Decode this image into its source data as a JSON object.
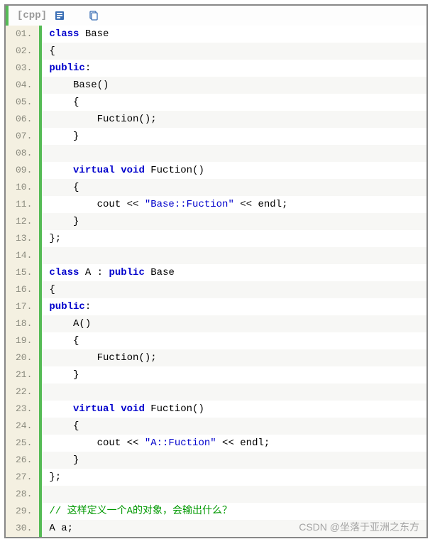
{
  "header": {
    "lang": "[cpp]"
  },
  "icons": {
    "view_plain": "view-plain-icon",
    "copy": "copy-icon"
  },
  "gutter_format": "00.",
  "lines": [
    [
      [
        "kw",
        "class"
      ],
      [
        "plain",
        " Base"
      ]
    ],
    [
      [
        "plain",
        "{"
      ]
    ],
    [
      [
        "kw",
        "public"
      ],
      [
        "plain",
        ":"
      ]
    ],
    [
      [
        "plain",
        "    Base()"
      ]
    ],
    [
      [
        "plain",
        "    {"
      ]
    ],
    [
      [
        "plain",
        "        Fuction();"
      ]
    ],
    [
      [
        "plain",
        "    }"
      ]
    ],
    [],
    [
      [
        "plain",
        "    "
      ],
      [
        "kw",
        "virtual"
      ],
      [
        "plain",
        " "
      ],
      [
        "kw",
        "void"
      ],
      [
        "plain",
        " Fuction()"
      ]
    ],
    [
      [
        "plain",
        "    {"
      ]
    ],
    [
      [
        "plain",
        "        cout << "
      ],
      [
        "str",
        "\"Base::Fuction\""
      ],
      [
        "plain",
        " << endl;"
      ]
    ],
    [
      [
        "plain",
        "    }"
      ]
    ],
    [
      [
        "plain",
        "};"
      ]
    ],
    [],
    [
      [
        "kw",
        "class"
      ],
      [
        "plain",
        " A : "
      ],
      [
        "kw",
        "public"
      ],
      [
        "plain",
        " Base"
      ]
    ],
    [
      [
        "plain",
        "{"
      ]
    ],
    [
      [
        "kw",
        "public"
      ],
      [
        "plain",
        ":"
      ]
    ],
    [
      [
        "plain",
        "    A()"
      ]
    ],
    [
      [
        "plain",
        "    {"
      ]
    ],
    [
      [
        "plain",
        "        Fuction();"
      ]
    ],
    [
      [
        "plain",
        "    }"
      ]
    ],
    [],
    [
      [
        "plain",
        "    "
      ],
      [
        "kw",
        "virtual"
      ],
      [
        "plain",
        " "
      ],
      [
        "kw",
        "void"
      ],
      [
        "plain",
        " Fuction()"
      ]
    ],
    [
      [
        "plain",
        "    {"
      ]
    ],
    [
      [
        "plain",
        "        cout << "
      ],
      [
        "str",
        "\"A::Fuction\""
      ],
      [
        "plain",
        " << endl;"
      ]
    ],
    [
      [
        "plain",
        "    }"
      ]
    ],
    [
      [
        "plain",
        "};"
      ]
    ],
    [],
    [
      [
        "comment",
        "// 这样定义一个A的对象，会输出什么？"
      ]
    ],
    [
      [
        "plain",
        "A a;"
      ]
    ]
  ],
  "watermark": "CSDN @坐落于亚洲之东方"
}
